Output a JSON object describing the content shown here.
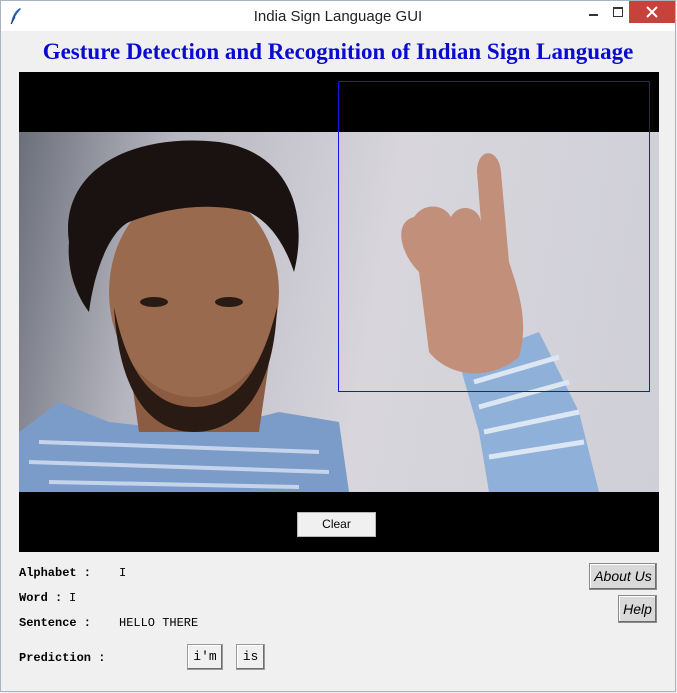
{
  "window": {
    "title": "India Sign Language GUI"
  },
  "heading": "Gesture Detection and Recognition of Indian Sign Language",
  "camera": {
    "clear_label": "Clear"
  },
  "results": {
    "alphabet_label": "Alphabet :",
    "alphabet_value": "I",
    "word_label": "Word :",
    "word_value": "I",
    "sentence_label": "Sentence :",
    "sentence_value": "HELLO THERE",
    "prediction_label": "Prediction :",
    "predictions": [
      "i'm",
      "is"
    ]
  },
  "side_buttons": {
    "about": "About Us",
    "help": "Help"
  },
  "colors": {
    "heading": "#0a0ad0",
    "roi_box": "#1515e6",
    "close_button": "#c7423a"
  }
}
